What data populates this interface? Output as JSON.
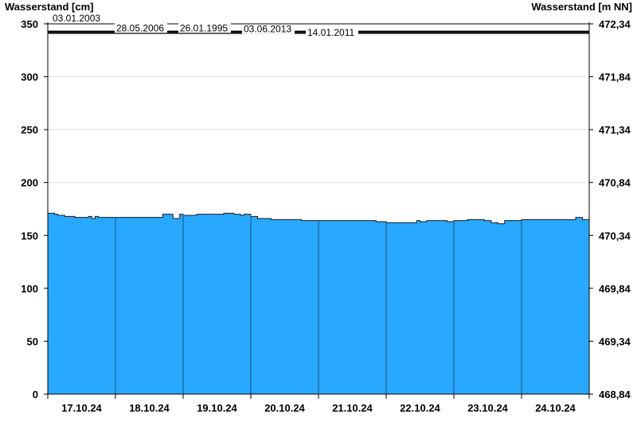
{
  "chart_data": {
    "type": "area",
    "ylabel_left": "Wasserstand [cm]",
    "ylabel_right": "Wasserstand [m NN]",
    "ylim": [
      0,
      350
    ],
    "yticks_left": [
      "0",
      "50",
      "100",
      "150",
      "200",
      "250",
      "300",
      "350"
    ],
    "yticks_right": [
      "468,84",
      "469,34",
      "469,84",
      "470,34",
      "470,84",
      "471,34",
      "471,84",
      "472,34"
    ],
    "x_range_days": [
      0,
      8
    ],
    "x_tick_labels": [
      "17.10.24",
      "18.10.24",
      "19.10.24",
      "20.10.24",
      "21.10.24",
      "22.10.24",
      "23.10.24",
      "24.10.24"
    ],
    "grid": true,
    "historic_floods": [
      {
        "date": "03.01.2003",
        "value": 350
      },
      {
        "date": "28.05.2006",
        "value": 343
      },
      {
        "date": "26.01.1995",
        "value": 343
      },
      {
        "date": "03.06.2013",
        "value": 342
      },
      {
        "date": "14.01.2011",
        "value": 341
      }
    ],
    "series": [
      {
        "x": [
          0,
          0.1,
          0.15,
          0.25,
          0.4,
          0.5,
          0.6,
          0.65,
          0.7,
          0.75,
          0.85,
          1.0,
          1.2,
          1.5,
          1.6,
          1.7,
          1.75,
          1.85,
          1.95,
          2.0,
          2.1,
          2.2,
          2.4,
          2.6,
          2.75,
          2.85,
          2.9,
          3.0,
          3.1,
          3.3,
          3.5,
          3.75,
          3.9,
          4.0,
          4.3,
          4.6,
          4.8,
          4.85,
          4.95,
          5.0,
          5.3,
          5.45,
          5.5,
          5.6,
          5.8,
          5.9,
          5.95,
          6.0,
          6.2,
          6.45,
          6.55,
          6.65,
          6.75,
          6.85,
          7.0,
          7.2,
          7.5,
          7.75,
          7.8,
          7.9,
          8.0
        ],
        "values": [
          171,
          170,
          169,
          168,
          167,
          167,
          168,
          166,
          168,
          167,
          167,
          167,
          167,
          167,
          167,
          170,
          170,
          166,
          170,
          169,
          169,
          170,
          170,
          171,
          170,
          169,
          170,
          168,
          166,
          165,
          165,
          164,
          164,
          164,
          164,
          164,
          164,
          163,
          163,
          162,
          162,
          164,
          163,
          164,
          164,
          163,
          163,
          164,
          165,
          164,
          162,
          161,
          164,
          164,
          165,
          165,
          165,
          165,
          167,
          165,
          165
        ]
      }
    ]
  }
}
